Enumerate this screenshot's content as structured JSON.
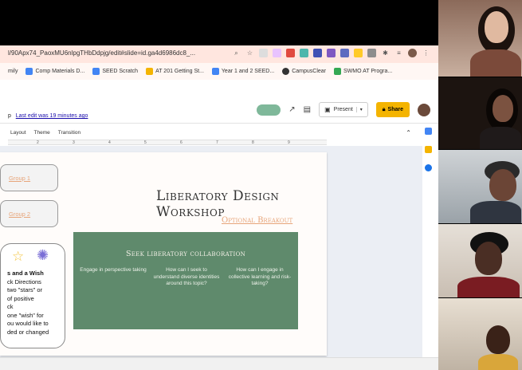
{
  "browser": {
    "url": "l/90Apx74_PaoxMU6nlpgTHbDdpjg/edit#slide=id.ga4d6986dc8_...",
    "bookmarks": [
      {
        "label": "mily",
        "color": "#ffffff"
      },
      {
        "label": "Comp Materials D...",
        "color": "#4285f4"
      },
      {
        "label": "SEED Scratch",
        "color": "#4285f4"
      },
      {
        "label": "AT 201 Getting St...",
        "color": "#f4b400"
      },
      {
        "label": "Year 1 and 2 SEED...",
        "color": "#4285f4"
      },
      {
        "label": "CampusClear",
        "color": "#333333"
      },
      {
        "label": "SWMO AT Progra...",
        "color": "#34a853"
      }
    ]
  },
  "app": {
    "title_fragment": "p",
    "last_edit": "Last edit was 19 minutes ago",
    "present_label": "Present",
    "share_label": "Share",
    "toolbar": [
      "Layout",
      "Theme",
      "Transition"
    ],
    "ruler_ticks": [
      "2",
      "3",
      "4",
      "5",
      "6",
      "7",
      "8",
      "9"
    ]
  },
  "slide": {
    "group_links": [
      "Group 1",
      "Group 2"
    ],
    "title": "Liberatory Design Workshop",
    "subtitle": "Optional Breakout",
    "star_card_lines": [
      {
        "text": "s and a Wish",
        "bold": true
      },
      {
        "text": "ck Directions",
        "bold": false
      },
      {
        "text": "two \"stars\" or",
        "bold": false
      },
      {
        "text": "of positive",
        "bold": false
      },
      {
        "text": "ck",
        "bold": false
      },
      {
        "text": "one \"wish\" for",
        "bold": false
      },
      {
        "text": "ou would like to",
        "bold": false
      },
      {
        "text": "ded or changed",
        "bold": false
      }
    ],
    "green_box": {
      "title": "Seek liberatory collaboration",
      "columns": [
        "Engage in perspective taking",
        "How can I seek to understand diverse identities around this topic?",
        "How can I engage in collective learning and risk-taking?"
      ]
    }
  },
  "colors": {
    "accent_share": "#f4b400",
    "slide_green": "#5f8a6c",
    "link_peach": "#e7a57a"
  }
}
